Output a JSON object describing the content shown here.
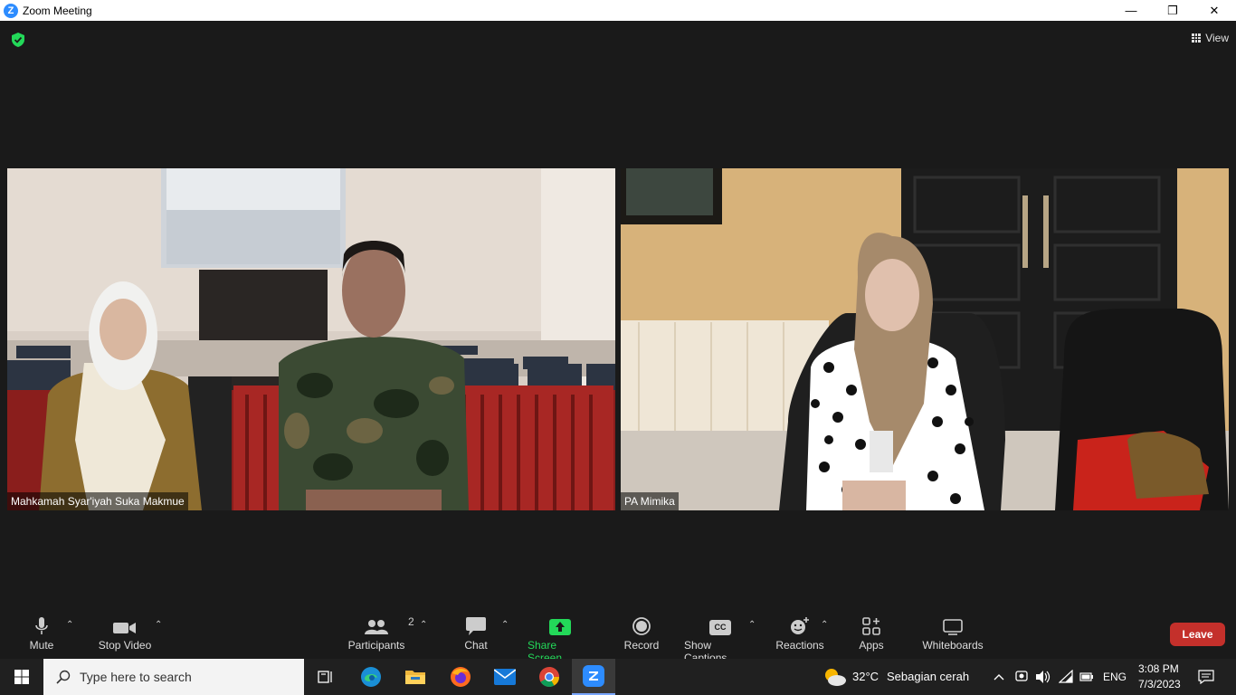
{
  "window": {
    "title": "Zoom Meeting",
    "logo_letter": "Z",
    "minimize": "—",
    "restore": "❐",
    "close": "✕"
  },
  "meeting": {
    "view_label": "View",
    "tiles": [
      {
        "label": "Mahkamah Syar'iyah Suka Makmue"
      },
      {
        "label": "PA Mimika"
      }
    ]
  },
  "toolbar": {
    "mute": "Mute",
    "stop_video": "Stop Video",
    "participants": "Participants",
    "participants_count": "2",
    "chat": "Chat",
    "share_screen": "Share Screen",
    "record": "Record",
    "show_captions": "Show Captions",
    "cc_badge": "CC",
    "reactions": "Reactions",
    "apps": "Apps",
    "whiteboards": "Whiteboards",
    "leave": "Leave",
    "caret": "⌃"
  },
  "taskbar": {
    "search_placeholder": "Type here to search",
    "weather_temp": "32°C",
    "weather_desc": "Sebagian cerah",
    "language": "ENG",
    "time": "3:08 PM",
    "date": "7/3/2023"
  },
  "colors": {
    "zoom_blue": "#2d8cff",
    "share_green": "#23d959",
    "leave_red": "#c4302b",
    "meeting_bg": "#1a1a1a",
    "taskbar_bg": "#202020"
  }
}
